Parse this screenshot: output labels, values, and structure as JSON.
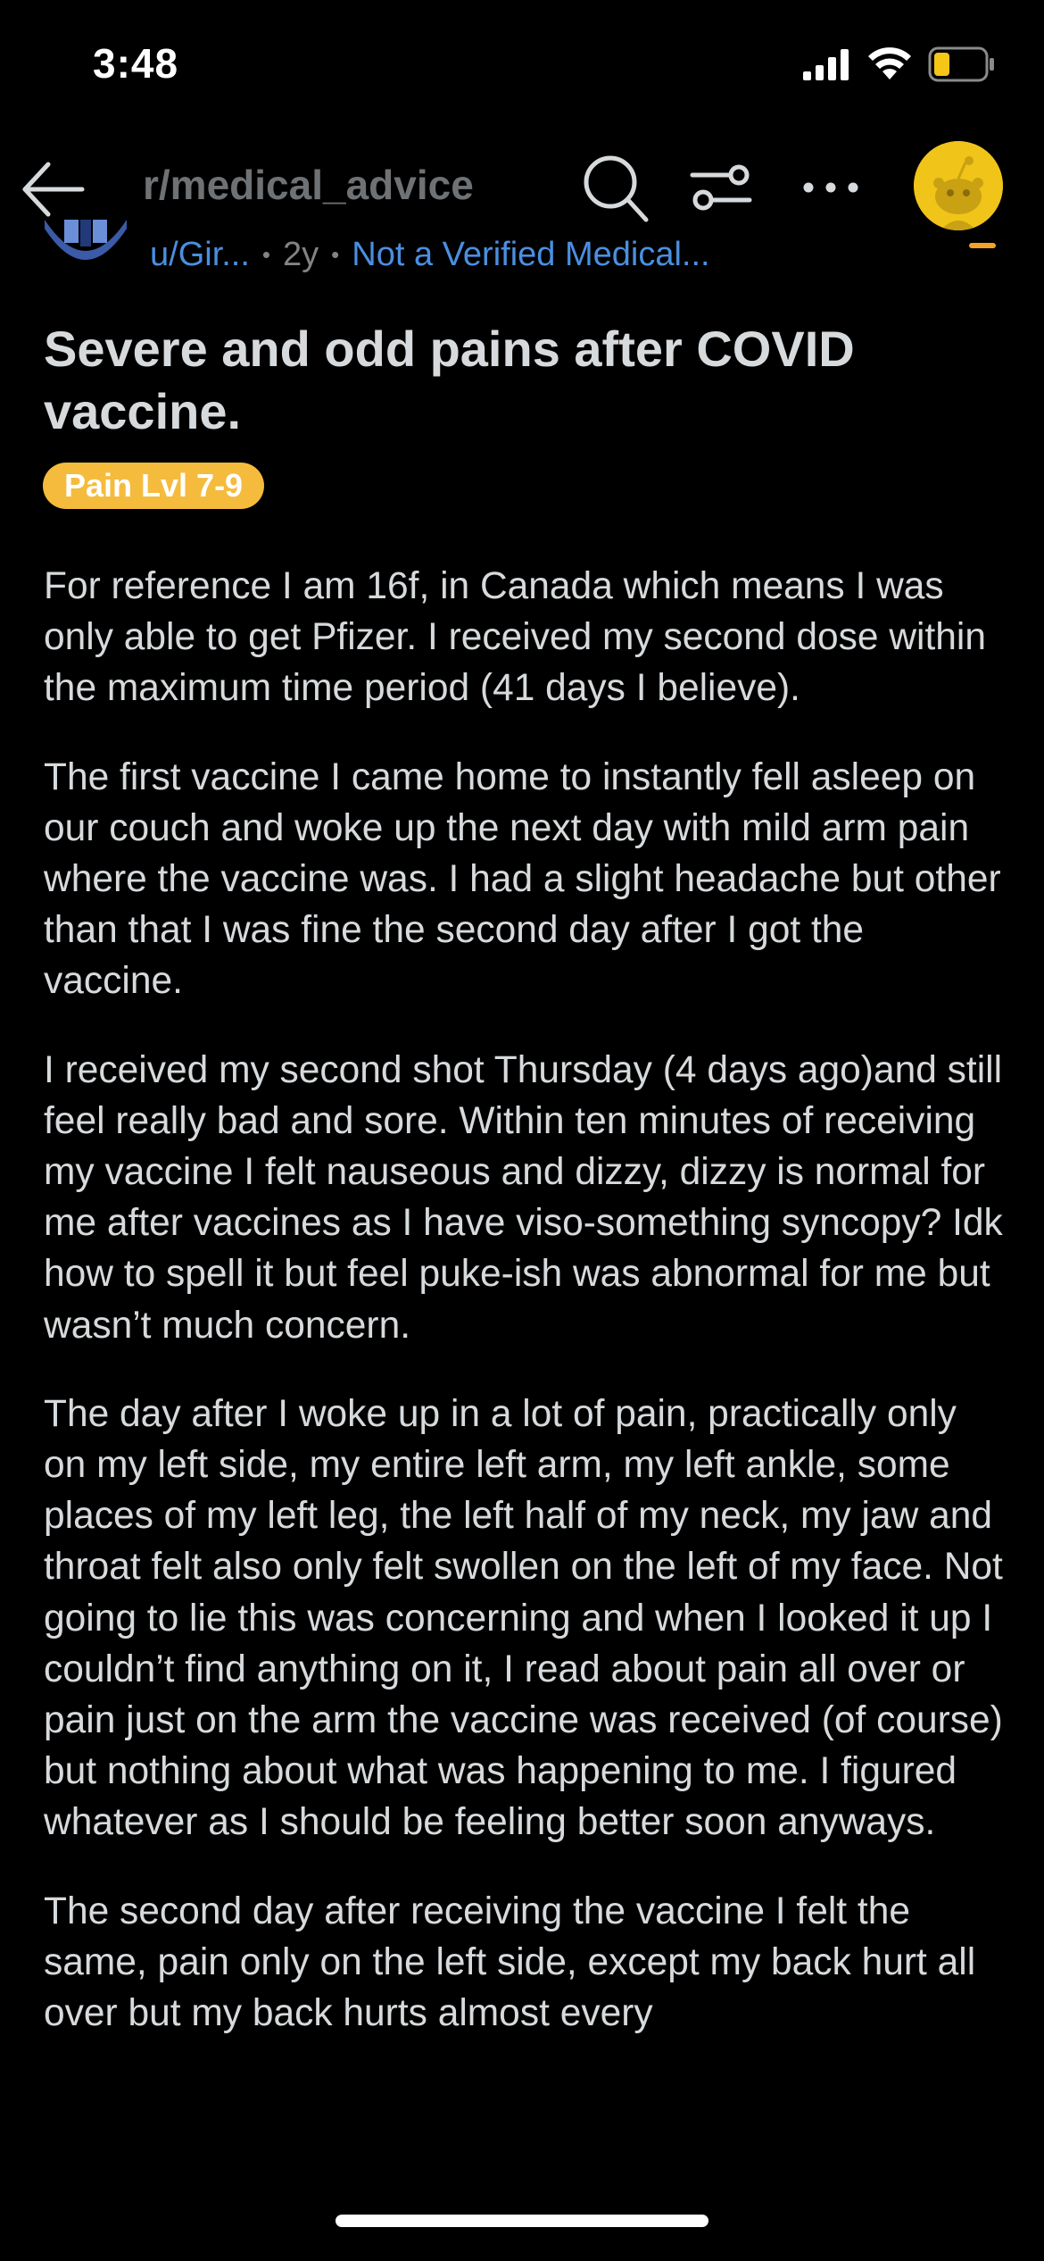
{
  "status_bar": {
    "time": "3:48",
    "icons": [
      "signal-icon",
      "wifi-icon",
      "battery-icon"
    ],
    "battery_color": "#f5c518"
  },
  "nav": {
    "subreddit": "r/medical_advice",
    "icons": [
      "back-arrow-icon",
      "search-icon",
      "sort-icon",
      "more-icon",
      "snoo-avatar-icon"
    ],
    "avatar_color": "#f0c419"
  },
  "meta": {
    "author": "u/Gir...",
    "separator": "•",
    "age": "2y",
    "author_flair": "Not a Verified Medical..."
  },
  "post": {
    "title": "Severe and odd pains after COVID vaccine.",
    "flair": "Pain Lvl 7-9",
    "flair_color": "#f5bb3c",
    "paragraphs": [
      "For reference I am 16f, in Canada which means I was only able to get Pfizer. I received my second dose within the maximum time period (41 days I believe).",
      "The first vaccine I came home to instantly fell asleep on our couch and woke up the next day with mild arm pain where the vaccine was. I had a slight headache but other than that I was fine the second day after I got the vaccine.",
      "I received my second shot Thursday (4 days ago)and still feel really bad and sore. Within ten minutes of receiving my vaccine I felt nauseous and dizzy, dizzy is normal for me after vaccines as I have viso-something syncopy? Idk how to spell it but feel puke-ish was abnormal for me but wasn’t much concern.",
      "The day after I woke up in a lot of pain, practically only on my left side, my entire left arm, my left ankle, some places of my left leg, the left half of my neck, my jaw and throat felt also only felt swollen on the left of my face. Not going to lie this was concerning and when I looked it up I couldn’t find anything on it, I read about pain all over or pain just on the arm the vaccine was received (of course) but nothing about what was happening to me. I figured whatever as I should be feeling better soon anyways.",
      "The second day after receiving the vaccine I felt the same, pain only on the left side, except my back hurt all over but my back hurts almost every"
    ]
  },
  "colors": {
    "background": "#000000",
    "text": "#d7dadc",
    "muted": "#818384",
    "link": "#4a8fe0"
  }
}
